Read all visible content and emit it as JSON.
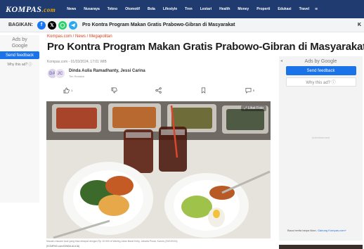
{
  "header": {
    "logo": "KOMPAS",
    "logo_suffix": ".com",
    "nav": [
      "News",
      "Nusaraya",
      "Tekno",
      "Otomotif",
      "Bola",
      "Lifestyle",
      "Tren",
      "Lestari",
      "Health",
      "Money",
      "Properti",
      "Edukasi",
      "Travel"
    ],
    "more_icon": "≡"
  },
  "sharebar": {
    "label": "BAGIKAN:",
    "icons": [
      "facebook-icon",
      "x-icon",
      "whatsapp-icon",
      "telegram-icon"
    ],
    "title": "Pro Kontra Program Makan Gratis Prabowo-Gibran di Masyarakat",
    "right_letter": "K"
  },
  "left_ad": {
    "ads_by": "Ads by",
    "google": "Google",
    "feedback": "Send feedback",
    "why": "Why this ad? ⓘ"
  },
  "article": {
    "breadcrumb": "Kompas.com / News / Megapolitan",
    "title": "Pro Kontra Program Makan Gratis Prabowo-Gibran di Masyarakat",
    "meta": "Kompas.com - 01/03/2024, 17:01 WIB",
    "avatars": [
      "DA",
      "JC"
    ],
    "authors": "Dinda Aulia Ramadhanty, Jessi Carina",
    "author_role": "Tim Redaksi",
    "actions": {
      "like_count": "1",
      "comment_count": "5"
    },
    "photo_button": "⤢ Lihat Foto",
    "caption": "Macam-macam lauk yang bisa didapat dengan Rp 15.000 di Warteg Jalan Barat Kelly, Jakarta Pusat, Kamis (29/2/2024).",
    "credit": "(KOMPAS.com/DINDA AULIA)"
  },
  "right_ad": {
    "ads_by": "Ads by Google",
    "feedback": "Send feedback",
    "why": "Why this ad? ⓘ",
    "advertisement": "Advertisement",
    "footer": "Baca berita tanpa iklan.",
    "footer_link": "Gabung Kompas.com+"
  },
  "colors": {
    "nav_bg": "#1f3b6f",
    "accent": "#d6411a",
    "google_blue": "#1a73e8"
  }
}
